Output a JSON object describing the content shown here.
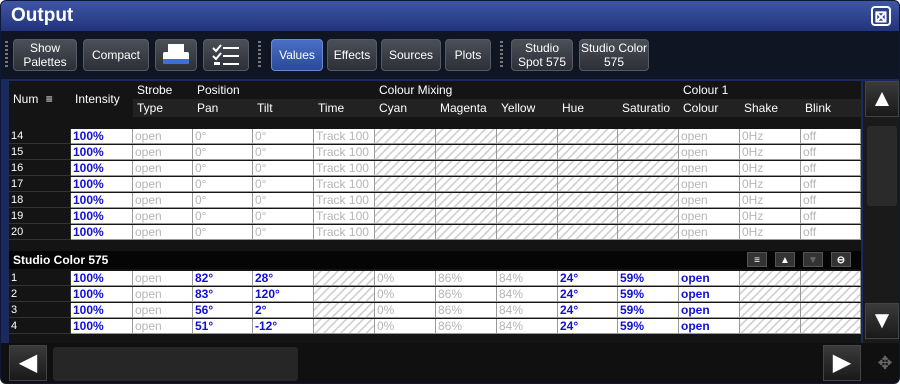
{
  "window": {
    "title": "Output",
    "close_glyph": "⊠"
  },
  "toolbar": {
    "show_palettes": "Show Palettes",
    "compact": "Compact",
    "printer_icon": "printer-icon",
    "checklist_icon": "checklist-icon",
    "tabs": [
      "Values",
      "Effects",
      "Sources",
      "Plots"
    ],
    "active_tab": "Values",
    "fixture_buttons": [
      "Studio Spot 575",
      "Studio Color 575"
    ]
  },
  "grid": {
    "group_headers": {
      "num": "Num",
      "intensity": "Intensity",
      "strobe": "Strobe",
      "position": "Position",
      "colour_mixing": "Colour Mixing",
      "colour1": "Colour 1"
    },
    "sub_headers": {
      "type": "Type",
      "pan": "Pan",
      "tilt": "Tilt",
      "time": "Time",
      "cyan": "Cyan",
      "magenta": "Magenta",
      "yellow": "Yellow",
      "hue": "Hue",
      "saturation": "Saturatio",
      "colour": "Colour",
      "shake": "Shake",
      "blink": "Blink"
    },
    "spot_rows": [
      {
        "num": "14",
        "intensity": "100%",
        "type": "open",
        "pan": "0°",
        "tilt": "0°",
        "time": "Track 100",
        "colour": "open",
        "shake": "0Hz",
        "blink": "off"
      },
      {
        "num": "15",
        "intensity": "100%",
        "type": "open",
        "pan": "0°",
        "tilt": "0°",
        "time": "Track 100",
        "colour": "open",
        "shake": "0Hz",
        "blink": "off"
      },
      {
        "num": "16",
        "intensity": "100%",
        "type": "open",
        "pan": "0°",
        "tilt": "0°",
        "time": "Track 100",
        "colour": "open",
        "shake": "0Hz",
        "blink": "off"
      },
      {
        "num": "17",
        "intensity": "100%",
        "type": "open",
        "pan": "0°",
        "tilt": "0°",
        "time": "Track 100",
        "colour": "open",
        "shake": "0Hz",
        "blink": "off"
      },
      {
        "num": "18",
        "intensity": "100%",
        "type": "open",
        "pan": "0°",
        "tilt": "0°",
        "time": "Track 100",
        "colour": "open",
        "shake": "0Hz",
        "blink": "off"
      },
      {
        "num": "19",
        "intensity": "100%",
        "type": "open",
        "pan": "0°",
        "tilt": "0°",
        "time": "Track 100",
        "colour": "open",
        "shake": "0Hz",
        "blink": "off"
      },
      {
        "num": "20",
        "intensity": "100%",
        "type": "open",
        "pan": "0°",
        "tilt": "0°",
        "time": "Track 100",
        "colour": "open",
        "shake": "0Hz",
        "blink": "off"
      }
    ],
    "section_title": "Studio Color 575",
    "color_rows": [
      {
        "num": "1",
        "intensity": "100%",
        "type": "open",
        "pan": "82°",
        "tilt": "28°",
        "cyan": "0%",
        "magenta": "86%",
        "yellow": "84%",
        "hue": "24°",
        "saturation": "59%",
        "colour": "open"
      },
      {
        "num": "2",
        "intensity": "100%",
        "type": "open",
        "pan": "83°",
        "tilt": "120°",
        "cyan": "0%",
        "magenta": "86%",
        "yellow": "84%",
        "hue": "24°",
        "saturation": "59%",
        "colour": "open"
      },
      {
        "num": "3",
        "intensity": "100%",
        "type": "open",
        "pan": "56°",
        "tilt": "2°",
        "cyan": "0%",
        "magenta": "86%",
        "yellow": "84%",
        "hue": "24°",
        "saturation": "59%",
        "colour": "open"
      },
      {
        "num": "4",
        "intensity": "100%",
        "type": "open",
        "pan": "51°",
        "tilt": "-12°",
        "cyan": "0%",
        "magenta": "86%",
        "yellow": "84%",
        "hue": "24°",
        "saturation": "59%",
        "colour": "open"
      }
    ]
  },
  "section_buttons": [
    "sort-icon",
    "up-icon",
    "down-icon",
    "remove-icon"
  ],
  "colors": {
    "value_blue": "#1010d0",
    "inactive_grey": "#b5b5b5",
    "title_blue": "#2e4290"
  }
}
